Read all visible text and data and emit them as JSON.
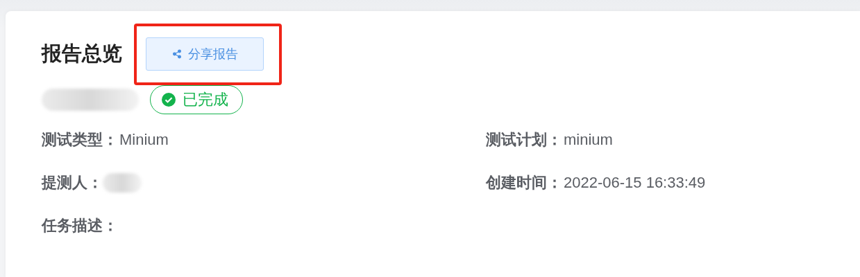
{
  "title": "报告总览",
  "share_button": {
    "label": "分享报告",
    "highlighted": true
  },
  "name": {
    "kind": "redacted"
  },
  "status": {
    "label": "已完成",
    "kind": "done"
  },
  "fields": [
    {
      "label": "测试类型：",
      "value": "Minium"
    },
    {
      "label": "测试计划：",
      "value": "minium"
    },
    {
      "label": "提测人：",
      "kind": "redacted"
    },
    {
      "label": "创建时间：",
      "value": "2022-06-15 16:33:49"
    },
    {
      "label": "任务描述："
    }
  ]
}
